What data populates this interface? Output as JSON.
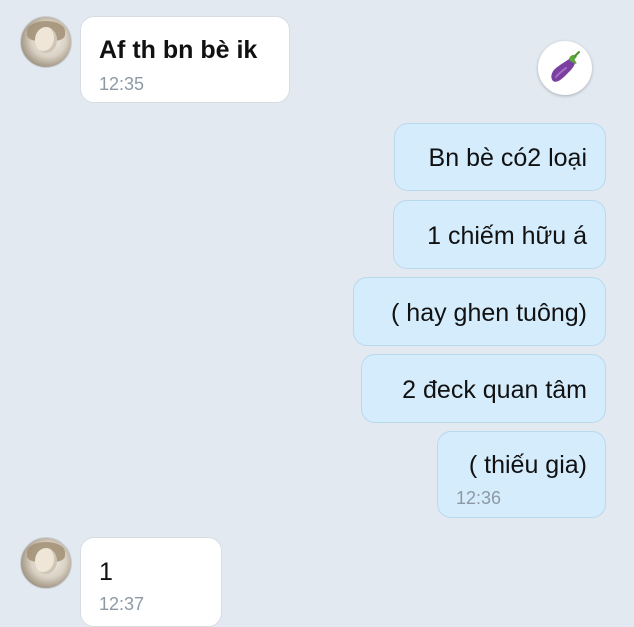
{
  "messages": [
    {
      "text": "Af th bn bè ik",
      "time": "12:35"
    },
    {
      "text": "Bn bè có2 loại"
    },
    {
      "text": "1 chiếm hữu á"
    },
    {
      "text": "( hay ghen tuông)"
    },
    {
      "text": "2 đeck quan tâm"
    },
    {
      "text": "( thiếu gia)",
      "time": "12:36"
    },
    {
      "text": "1",
      "time": "12:37"
    }
  ],
  "reaction_icon": "eggplant-icon",
  "colors": {
    "background": "#e2e9f1",
    "incoming_bubble": "#ffffff",
    "outgoing_bubble": "#d4ecfb",
    "timestamp": "#8e99a6"
  }
}
